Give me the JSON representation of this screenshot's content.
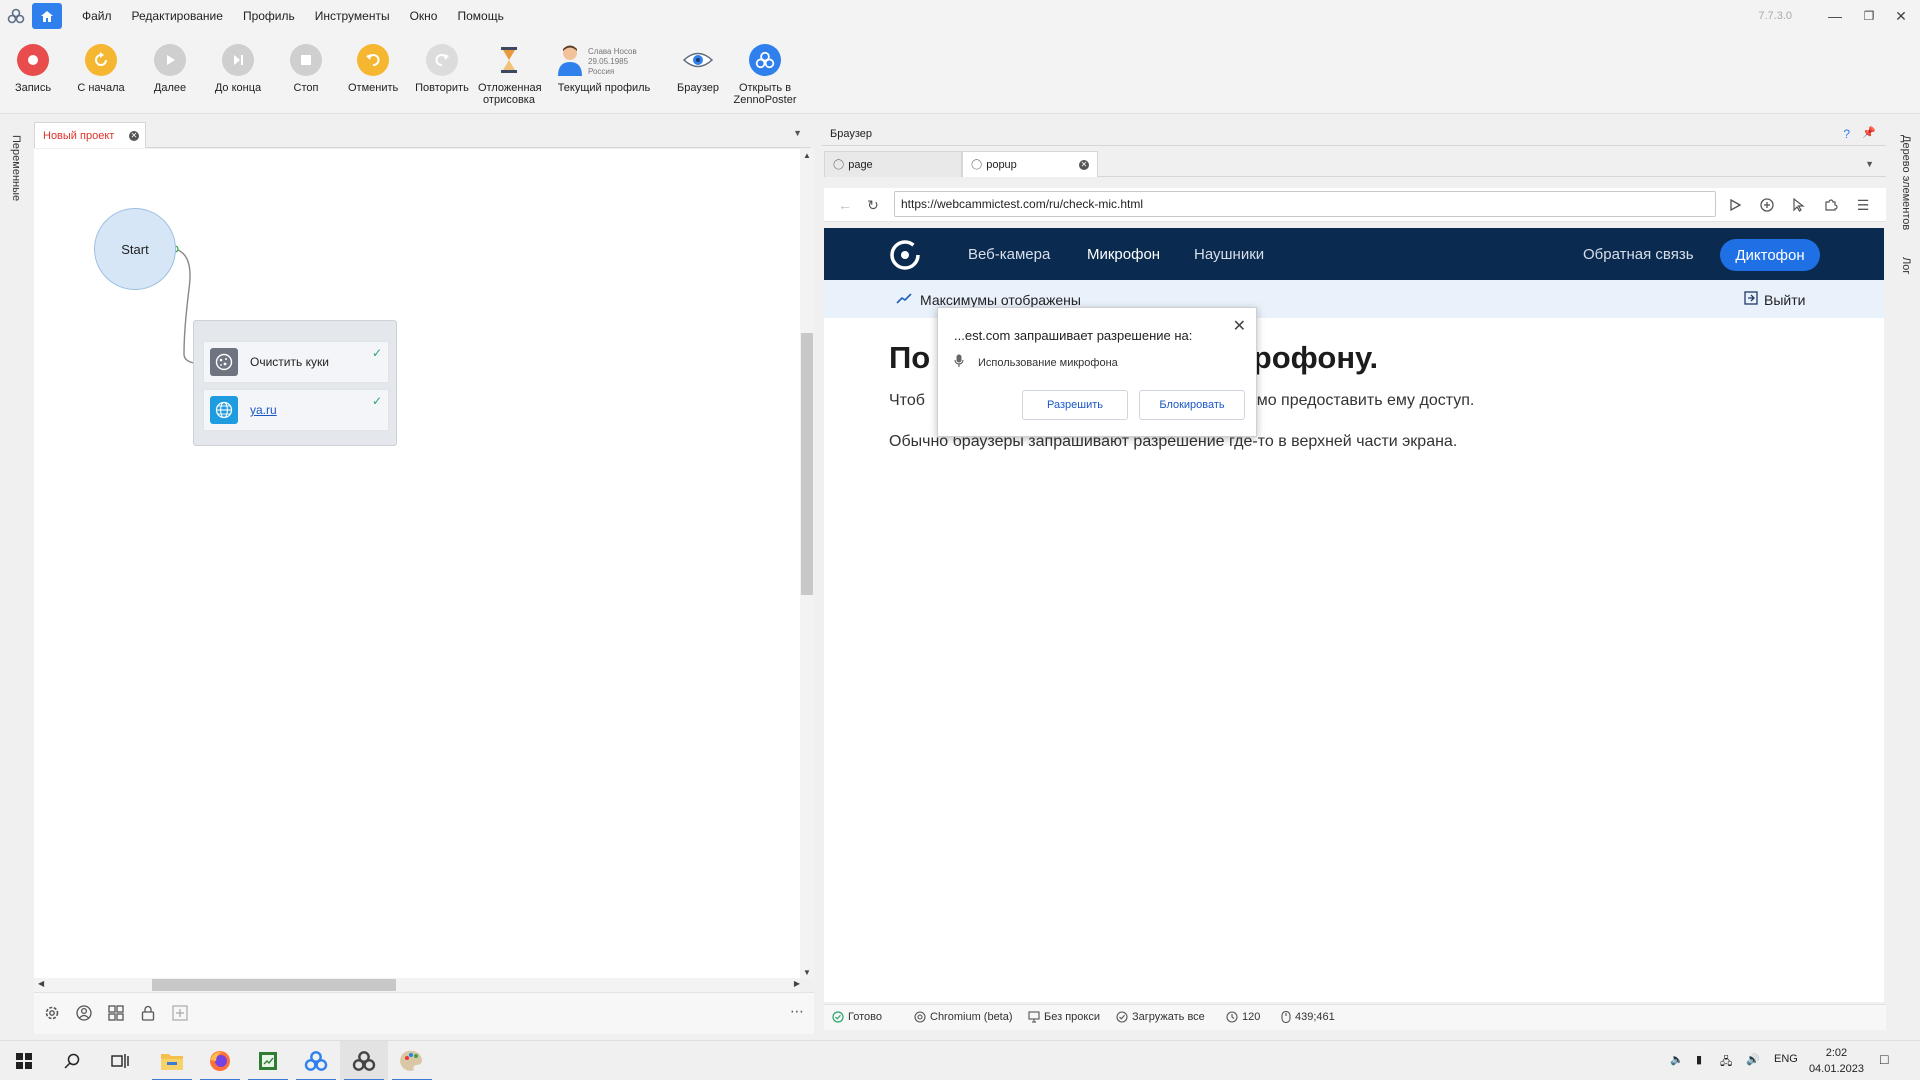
{
  "app": {
    "version": "7.7.3.0",
    "menu": [
      "Файл",
      "Редактирование",
      "Профиль",
      "Инструменты",
      "Окно",
      "Помощь"
    ]
  },
  "toolbar": {
    "record": "Запись",
    "restart": "С начала",
    "next": "Далее",
    "to_end": "До конца",
    "stop": "Стоп",
    "undo": "Отменить",
    "redo": "Повторить",
    "deferred_1": "Отложенная",
    "deferred_2": "отрисовка",
    "profile_name": "Слава Носов",
    "profile_date": "29.05.1985",
    "profile_country": "Россия",
    "current_profile": "Текущий профиль",
    "browser": "Браузер",
    "open_in_1": "Открыть в",
    "open_in_2": "ZennoPoster"
  },
  "side": {
    "left_tab": "Переменные",
    "right_tab_1": "Дерево элементов",
    "right_tab_2": "Лог"
  },
  "project": {
    "tab_label": "Новый проект",
    "start_node": "Start",
    "actions": [
      {
        "label": "Очистить куки"
      },
      {
        "label": "ya.ru"
      }
    ]
  },
  "browser": {
    "header": "Браузер",
    "help": "?",
    "tabs": [
      {
        "label": "page"
      },
      {
        "label": "popup"
      }
    ],
    "url": "https://webcammictest.com/ru/check-mic.html",
    "site": {
      "nav": [
        "Веб-камера",
        "Микрофон",
        "Наушники"
      ],
      "feedback": "Обратная связь",
      "dictaphone": "Диктофон",
      "sub_text": "Максимумы отображены",
      "logout": "Выйти",
      "heading_left": "По",
      "heading_right": "икрофону.",
      "para1_left": "Чтоб",
      "para1_right": "одимо предоставить ему доступ.",
      "para2": "Обычно браузеры запрашивают разрешение где-то в верхней части экрана."
    },
    "permission": {
      "title": "...est.com запрашивает разрешение на:",
      "item": "Использование микрофона",
      "allow": "Разрешить",
      "block": "Блокировать"
    },
    "status": {
      "ready": "Готово",
      "engine": "Chromium (beta)",
      "proxy": "Без прокси",
      "load": "Загружать все",
      "timeout": "120",
      "coords": "439;461"
    }
  },
  "taskbar": {
    "lang": "ENG",
    "time": "2:02",
    "date": "04.01.2023"
  },
  "colors": {
    "accent": "#2f80ed",
    "site_nav": "#0b2a4f",
    "site_button": "#1f6fe5",
    "record": "#e84c4c",
    "restart": "#f5b731",
    "tab_active_text": "#e0322a"
  }
}
